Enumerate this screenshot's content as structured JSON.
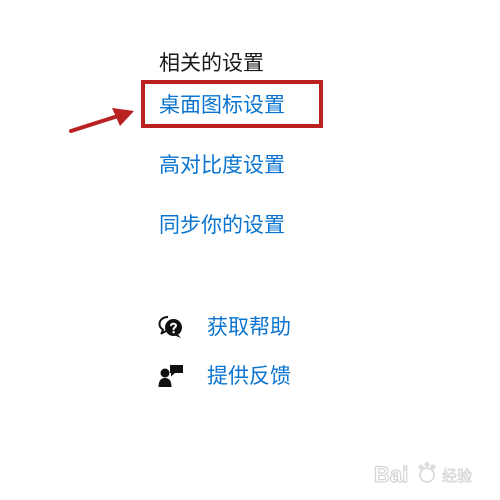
{
  "related": {
    "heading": "相关的设置",
    "links": [
      {
        "label": "桌面图标设置",
        "highlighted": true
      },
      {
        "label": "高对比度设置"
      },
      {
        "label": "同步你的设置"
      }
    ]
  },
  "support": {
    "help": {
      "label": "获取帮助",
      "icon": "help-chat-icon"
    },
    "feedback": {
      "label": "提供反馈",
      "icon": "feedback-person-icon"
    }
  },
  "annotation": {
    "highlight_color": "#b92020",
    "link_color": "#0a74d0"
  },
  "watermark": {
    "text": "Baidu 经验"
  }
}
